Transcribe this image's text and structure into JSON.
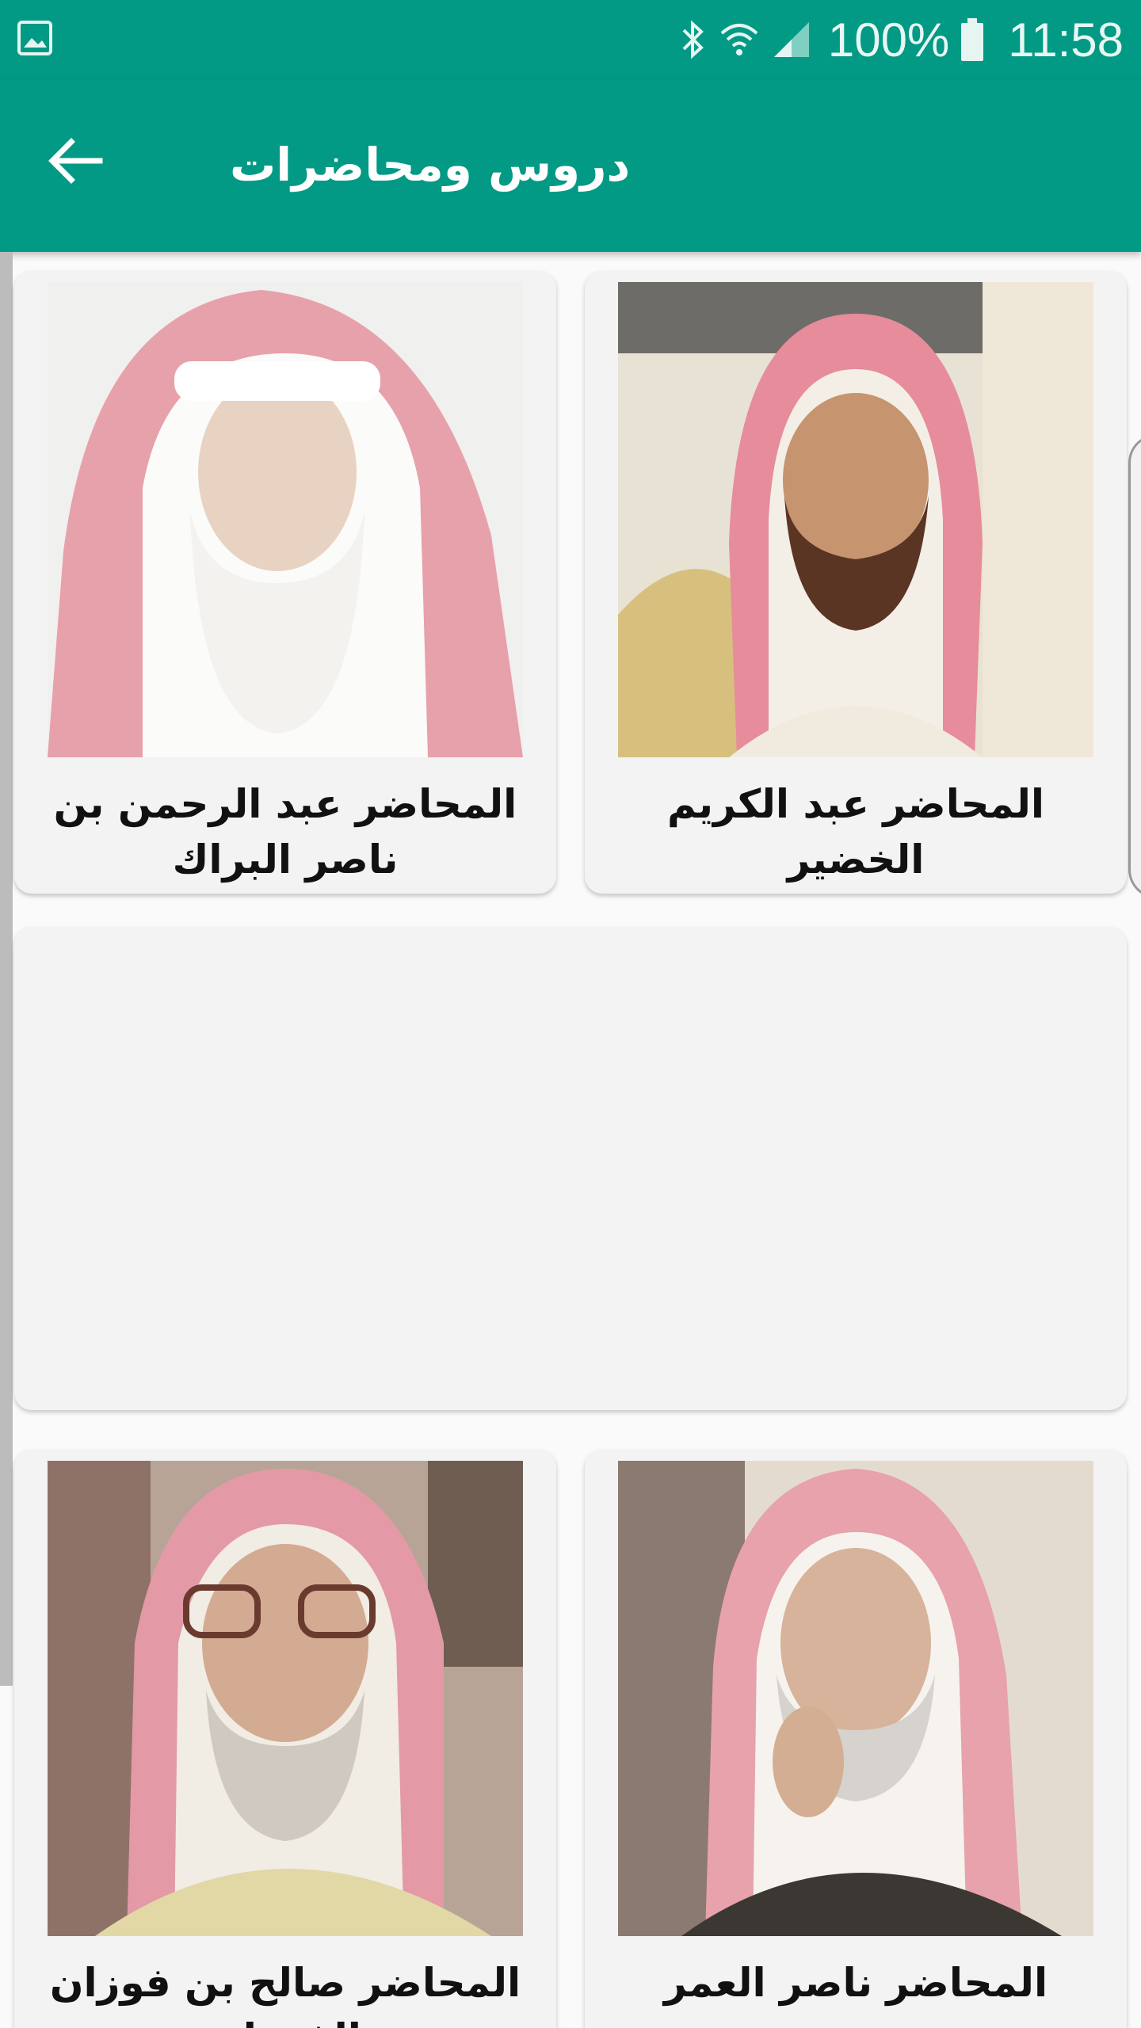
{
  "status_bar": {
    "battery": "100%",
    "time": "11:58",
    "icons": [
      "image-icon",
      "bluetooth-icon",
      "wifi-icon",
      "signal-icon",
      "battery-icon"
    ]
  },
  "toolbar": {
    "title": "دروس ومحاضرات",
    "back_icon": "arrow-left-icon"
  },
  "colors": {
    "primary": "#029a84",
    "card_bg": "#f3f3f3",
    "keffiyeh_red": "#d9566a"
  },
  "lecturers": [
    {
      "name": "المحاضر عبد الكريم الخضير"
    },
    {
      "name": "المحاضر عبد الرحمن بن ناصر البراك"
    },
    {
      "name": "المحاضر ناصر العمر"
    },
    {
      "name": "المحاضر صالح بن فوزان الفوزان"
    }
  ]
}
